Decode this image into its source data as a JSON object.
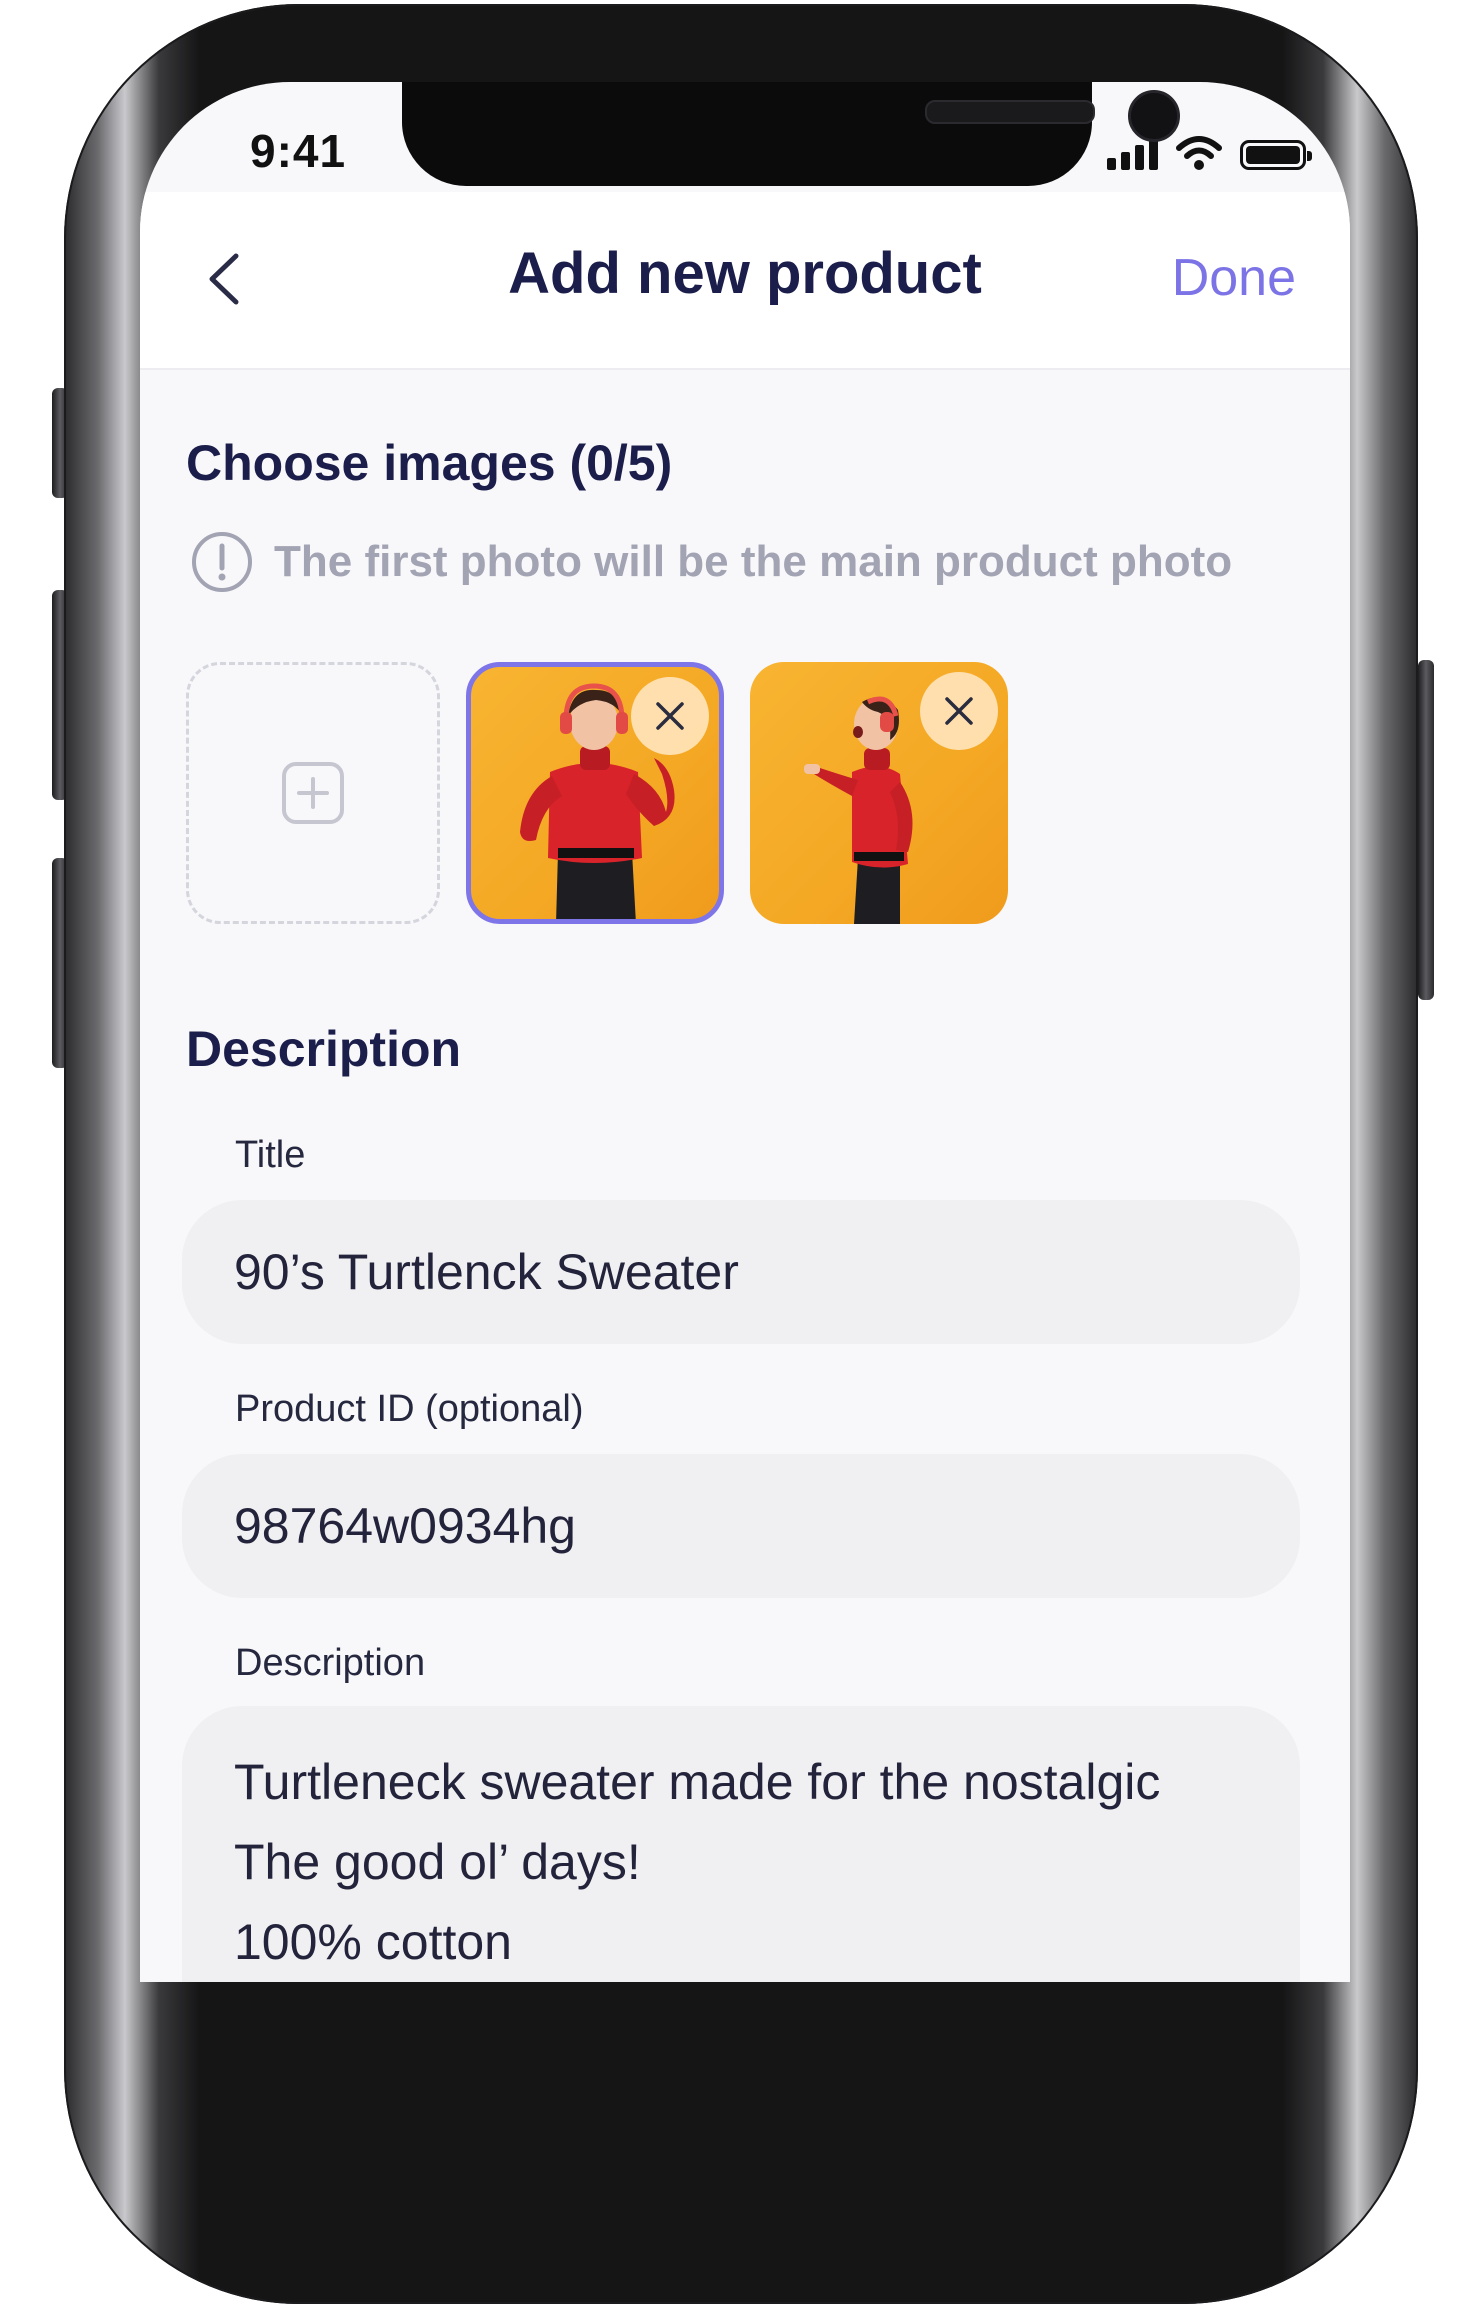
{
  "status_bar": {
    "time": "9:41"
  },
  "header": {
    "title": "Add new product",
    "done_label": "Done"
  },
  "images": {
    "title": "Choose images (0/5)",
    "hint": "The first photo will be the main product photo"
  },
  "description_section": {
    "title": "Description"
  },
  "form": {
    "title_label": "Title",
    "title_value": "90’s  Turtlenck Sweater",
    "product_id_label": "Product ID (optional)",
    "product_id_value": "98764w0934hg",
    "description_label": "Description",
    "description_lines": [
      "Turtleneck sweater made for the nostalgic",
      "The good ol’ days!",
      "100% cotton"
    ]
  },
  "colors": {
    "accent": "#7c74e6",
    "heading": "#1b1d4a",
    "photo_bg": "#f4a824",
    "sweater": "#d8232a"
  },
  "icons": [
    "back-icon",
    "done",
    "alert-icon",
    "add-image-icon",
    "close-icon",
    "signal-icon",
    "wifi-icon",
    "battery-icon"
  ]
}
